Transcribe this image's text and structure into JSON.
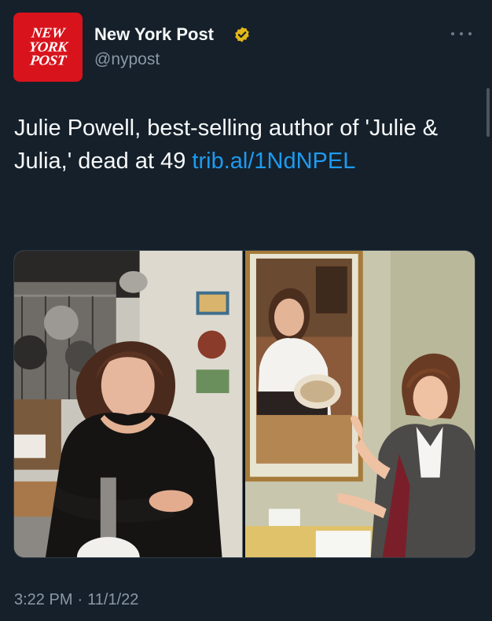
{
  "author": {
    "avatar_words": [
      "NEW",
      "YORK",
      "POST"
    ],
    "name": "New York Post",
    "handle": "@nypost",
    "verified_badge_icon": "verified-gold-badge-icon",
    "avatar_color": "#d8131c"
  },
  "menu": {
    "icon": "more-dots-icon"
  },
  "tweet": {
    "text": "Julie Powell, best-selling author of 'Julie & Julia,' dead at 49 ",
    "link_text": "trib.al/1NdNPEL",
    "link_color": "#1d9bf0"
  },
  "media": {
    "photos": [
      "photo-julie-powell-kitchen",
      "photo-julia-child-portrait-scene"
    ]
  },
  "meta": {
    "time": "3:22 PM",
    "separator": "·",
    "date": "11/1/22"
  },
  "theme": {
    "background": "#15202b",
    "text": "#f7f9f9",
    "secondary_text": "#8b98a5"
  }
}
